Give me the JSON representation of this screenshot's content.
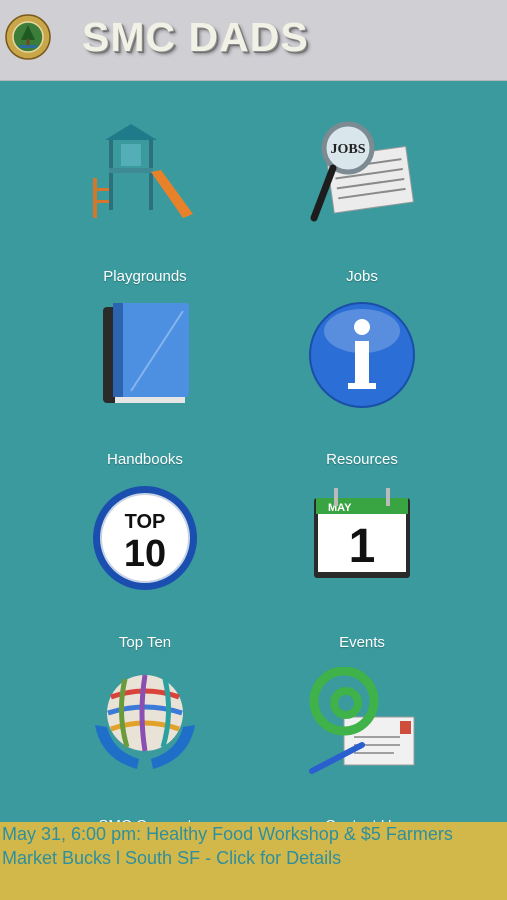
{
  "header": {
    "title": "SMC DADS",
    "logo_icon": "county-seal-icon"
  },
  "tiles": [
    {
      "label": "Playgrounds",
      "icon": "playground-icon"
    },
    {
      "label": "Jobs",
      "icon": "jobs-magnifier-icon"
    },
    {
      "label": "Handbooks",
      "icon": "book-icon"
    },
    {
      "label": "Resources",
      "icon": "info-icon"
    },
    {
      "label": "Top Ten",
      "icon": "top-ten-badge-icon"
    },
    {
      "label": "Events",
      "icon": "calendar-icon"
    },
    {
      "label": "SMC Connect",
      "icon": "globe-hands-icon"
    },
    {
      "label": "Contact Us",
      "icon": "email-at-icon"
    }
  ],
  "icon_text": {
    "jobs": "JOBS",
    "top_line": "TOP",
    "ten": "10",
    "month": "MAY",
    "day": "1"
  },
  "banner": {
    "text": "May 31, 6:00 pm: Healthy Food Workshop & $5 Farmers Market Bucks l South SF - Click for Details"
  },
  "colors": {
    "background": "#3a9a9d",
    "header": "#cfcfd4",
    "banner": "#d2b84b",
    "banner_text": "#2f8f9c"
  }
}
